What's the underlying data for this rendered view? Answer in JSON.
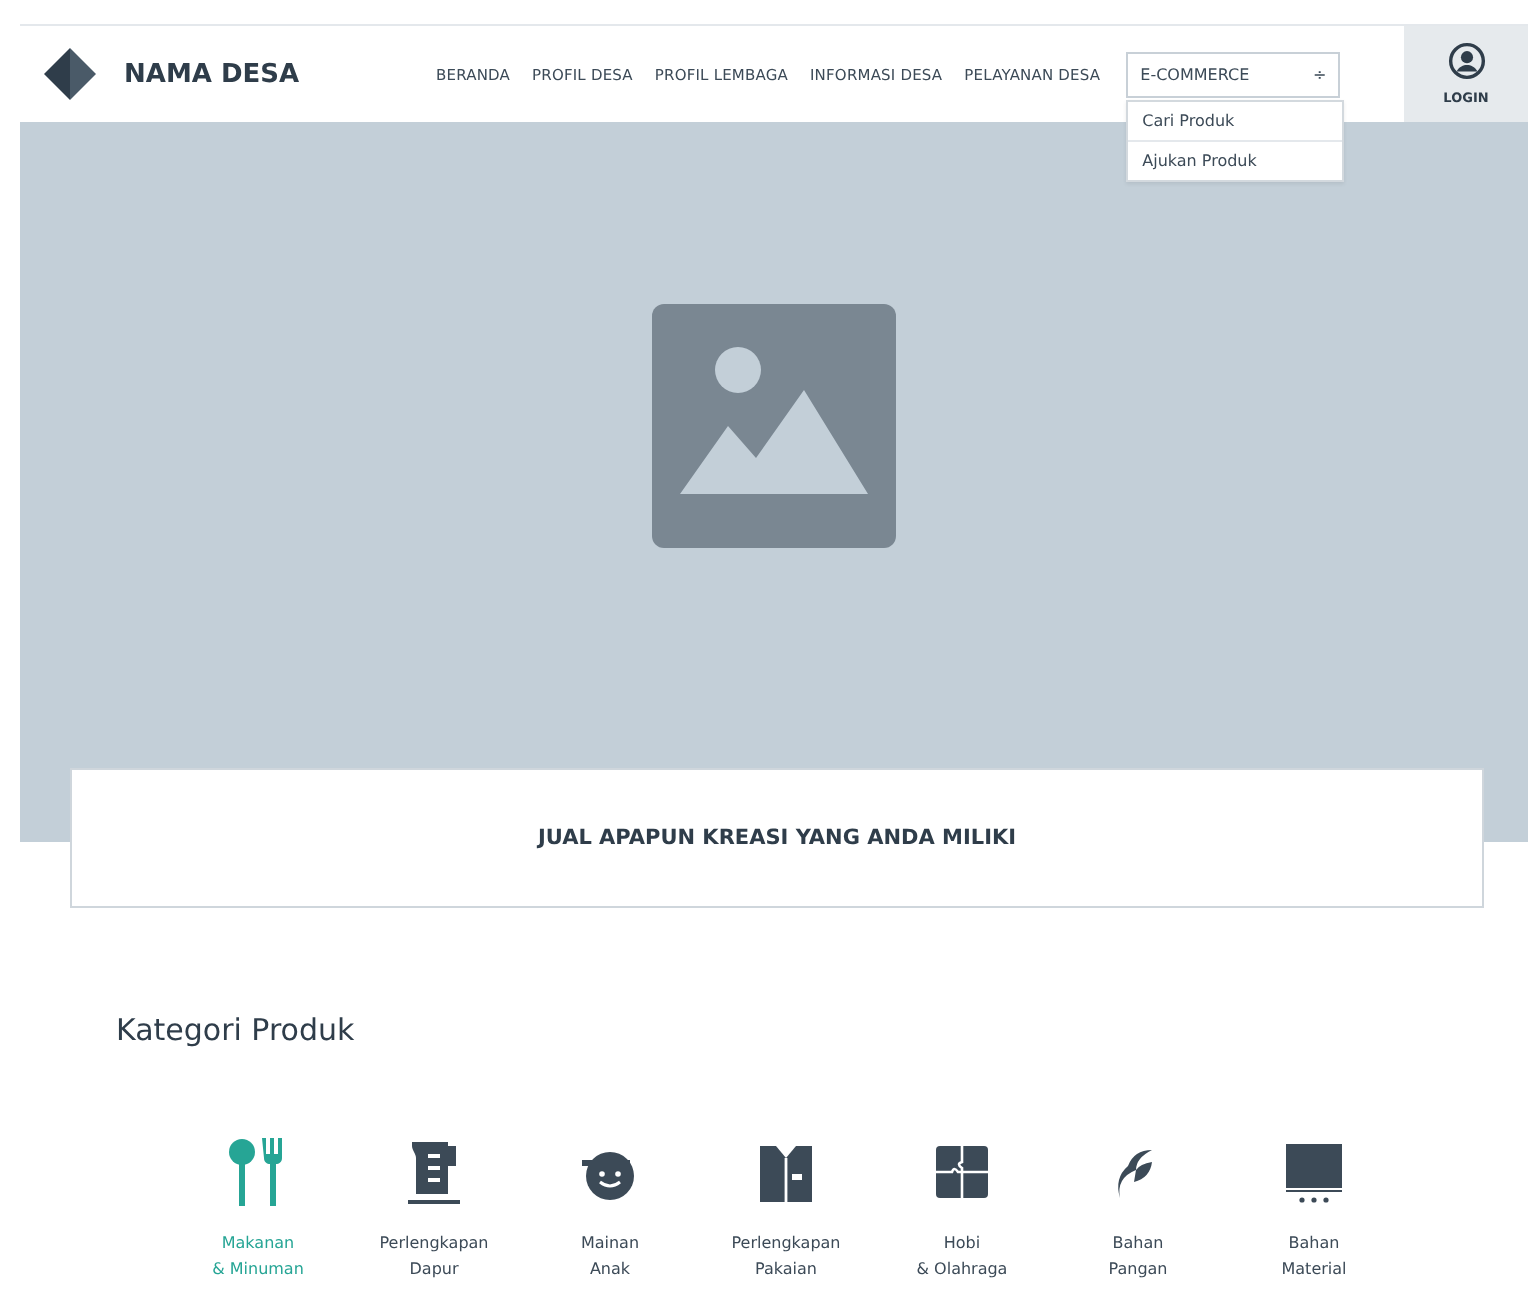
{
  "header": {
    "site_name": "NAMA DESA",
    "nav": [
      {
        "label": "BERANDA"
      },
      {
        "label": "PROFIL DESA"
      },
      {
        "label": "PROFIL LEMBAGA"
      },
      {
        "label": "INFORMASI DESA"
      },
      {
        "label": "PELAYANAN DESA"
      }
    ],
    "dropdown": {
      "label": "E-COMMERCE",
      "arrow": "÷",
      "expanded": true,
      "items": [
        {
          "label": "Cari Produk"
        },
        {
          "label": "Ajukan Produk"
        }
      ]
    },
    "login": "LOGIN"
  },
  "banner": {
    "text": "JUAL APAPUN KREASI YANG ANDA MILIKI"
  },
  "categories": {
    "title": "Kategori Produk",
    "items": [
      {
        "line1": "Makanan",
        "line2": "& Minuman",
        "selected": true
      },
      {
        "line1": "Perlengkapan",
        "line2": "Dapur",
        "selected": false
      },
      {
        "line1": "Mainan",
        "line2": "Anak",
        "selected": false
      },
      {
        "line1": "Perlengkapan",
        "line2": "Pakaian",
        "selected": false
      },
      {
        "line1": "Hobi",
        "line2": "& Olahraga",
        "selected": false
      },
      {
        "line1": "Bahan",
        "line2": "Pangan",
        "selected": false
      },
      {
        "line1": "Bahan",
        "line2": "Material",
        "selected": false
      }
    ]
  }
}
